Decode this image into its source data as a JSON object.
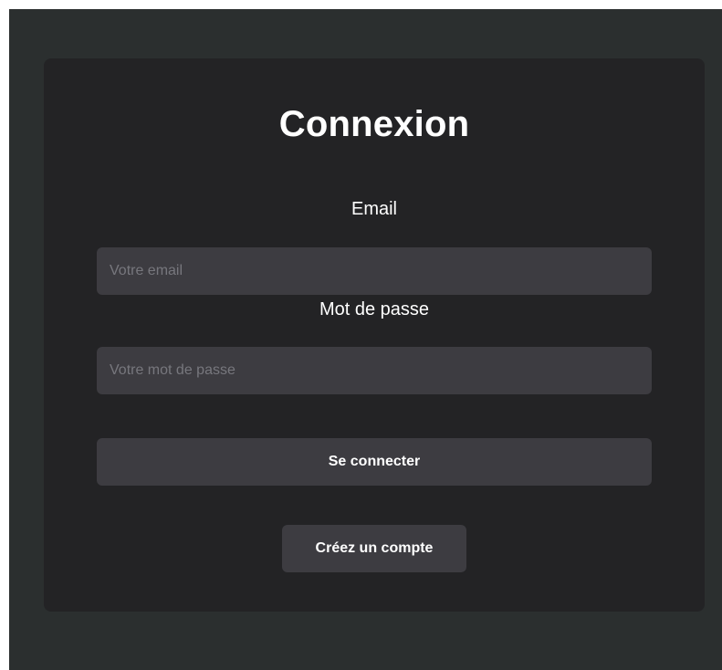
{
  "form": {
    "title": "Connexion",
    "email": {
      "label": "Email",
      "placeholder": "Votre email",
      "value": ""
    },
    "password": {
      "label": "Mot de passe",
      "placeholder": "Votre mot de passe",
      "value": ""
    },
    "submit_label": "Se connecter",
    "register_label": "Créez un compte"
  },
  "colors": {
    "page_background": "#2b2f2f",
    "card_background": "#232325",
    "field_background": "#3d3c41",
    "text": "#ffffff",
    "placeholder": "#77777d"
  }
}
